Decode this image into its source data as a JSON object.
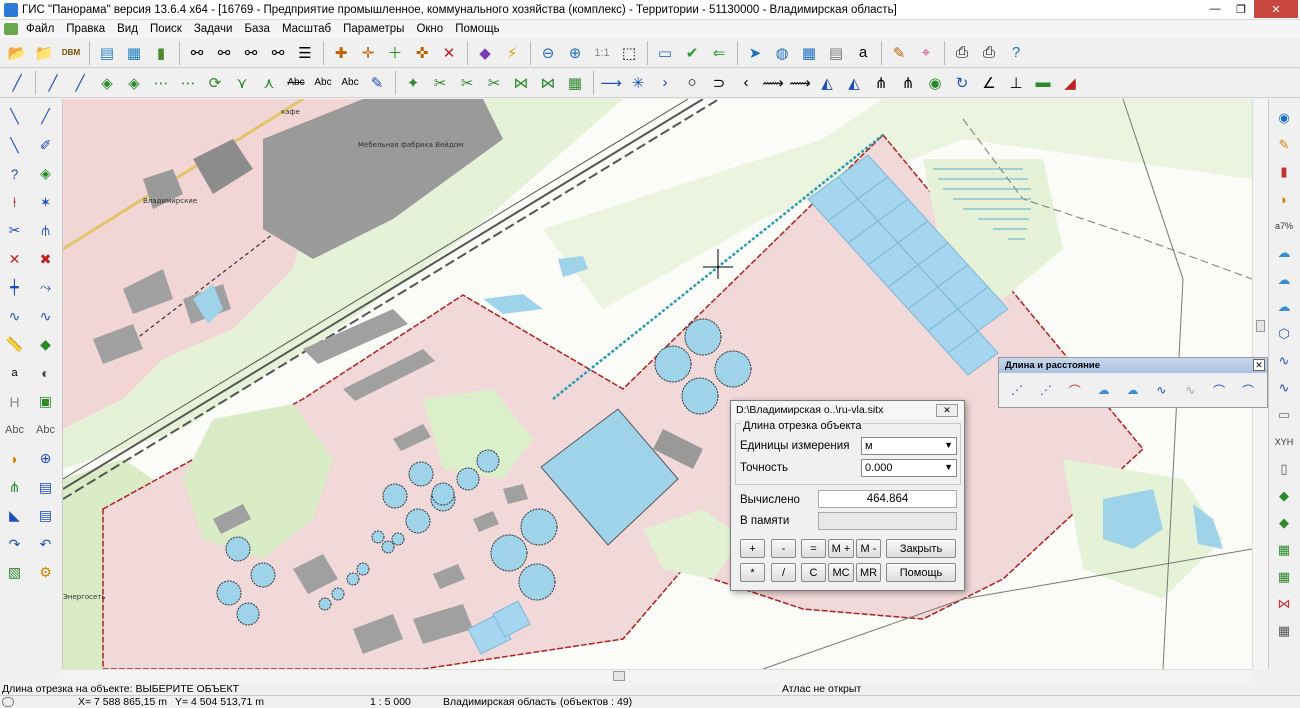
{
  "window": {
    "title": "ГИС \"Панорама\" версия 13.6.4 x64 - [16769 - Предприятие промышленное, коммунального хозяйства (комплекс) - Территории - 51130000 - Владимирская область]",
    "minimize": "—",
    "maximize": "❐",
    "close": "✕"
  },
  "menu": [
    "Файл",
    "Правка",
    "Вид",
    "Поиск",
    "Задачи",
    "База",
    "Масштаб",
    "Параметры",
    "Окно",
    "Помощь"
  ],
  "toolbar_icons_row1": [
    "open-folder-icon",
    "save-icon",
    "dbm-icon",
    "layers-icon",
    "view-icon",
    "binoculars-icon",
    "binoculars-a-icon",
    "binoculars-2-icon",
    "binoculars-3-icon",
    "list-icon",
    "select-cross-icon",
    "select-point-icon",
    "add-icon",
    "select-icon",
    "delete-icon",
    "cube-icon",
    "flash-icon",
    "zoom-out-icon",
    "zoom-in-icon",
    "scale-1-1-icon",
    "fit-icon",
    "frame-icon",
    "check-icon",
    "back-icon",
    "pointer-icon",
    "globe-icon",
    "grid-icon",
    "dbm-2-icon",
    "text-a-icon",
    "palette-icon",
    "pin-icon",
    "print-icon",
    "print-2-icon",
    "help-icon"
  ],
  "toolbar_row1_labels": {
    "scale_label": "1:1",
    "dbm": "DBM"
  },
  "toolbar_row2_labels": {
    "abc1": "Abc",
    "abc2": "Abc",
    "abc3": "Abc"
  },
  "left_tool_labels": {
    "h": "H",
    "abc_left": "Abc",
    "abc_right": "Abc",
    "a_sub": "a"
  },
  "right_tool_labels": {
    "percent": "a7%",
    "xy": "XYH"
  },
  "map_labels": {
    "furniture": "Мебельная фабрика Вейдом",
    "vladimir": "Владимирские",
    "energy": "Энергосеть",
    "cafe": "кафе"
  },
  "panel_distance": {
    "title": "Длина и расстояние",
    "close": "✕"
  },
  "dialog": {
    "title": "D:\\Владимирская о..\\ru-vla.sitx",
    "close": "✕",
    "group_label": "Длина отрезка объекта",
    "units_label": "Единицы измерения",
    "units_value": "м",
    "precision_label": "Точность",
    "precision_value": "0.000",
    "computed_label": "Вычислено",
    "computed_value": "464.864",
    "memory_label": "В памяти",
    "memory_value": "",
    "buttons": {
      "plus": "+",
      "minus": "-",
      "equals": "=",
      "mplus": "M +",
      "mminus": "M -",
      "close": "Закрыть",
      "mult": "*",
      "div": "/",
      "c": "C",
      "mc": "MC",
      "mr": "MR",
      "help": "Помощь"
    }
  },
  "status": {
    "hint": "Длина отрезка на объекте: ВЫБЕРИТЕ ОБЪЕКТ",
    "atlas": "Атлас не открыт",
    "x": "X= 7 588 865,15 m",
    "y": "Y= 4 504 513,71 m",
    "scale": "1 : 5 000",
    "region": "Владимирская область",
    "objects": "(объектов : 49)"
  },
  "colors": {
    "industrial": "#f2d6d6",
    "green": "#d9ecc6",
    "water": "#9fd3ea",
    "building": "#999999",
    "boundary": "#b02020",
    "rail": "#555555"
  }
}
